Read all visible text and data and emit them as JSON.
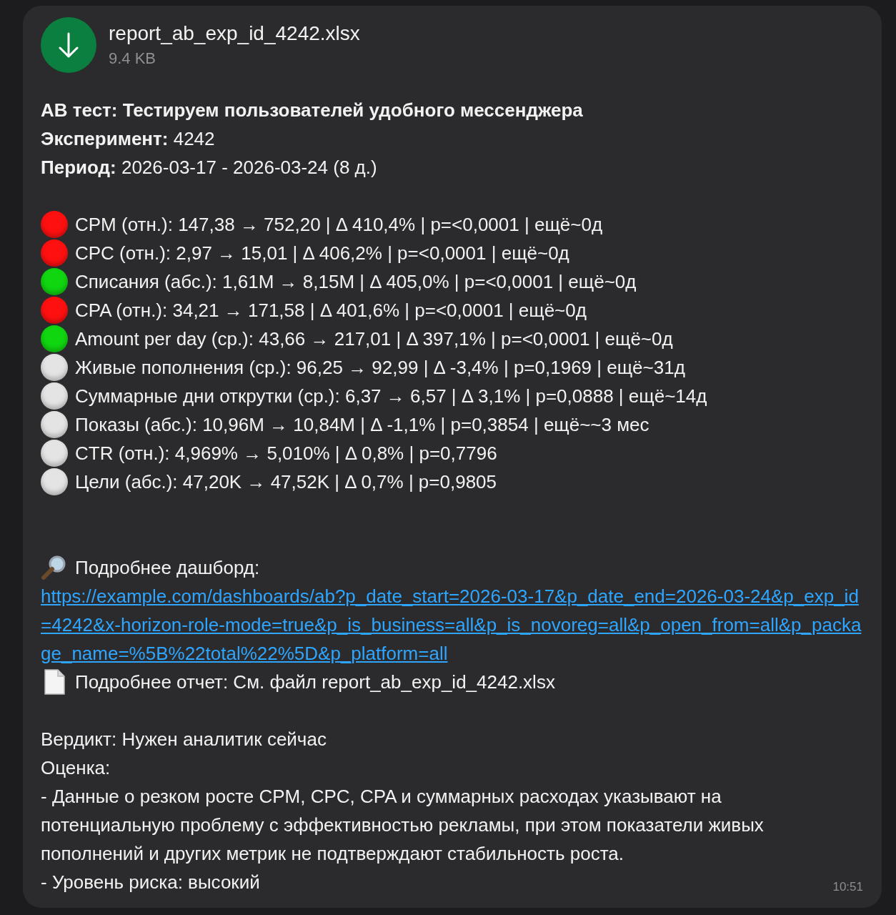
{
  "file": {
    "name": "report_ab_exp_id_4242.xlsx",
    "size": "9.4 KB"
  },
  "title": "АВ тест: Тестируем пользователей удобного мессенджера",
  "header_lines": [
    "**Эксперимент:** 4242",
    "**Период:** 2026-03-17 - 2026-03-24 (8 д.)"
  ],
  "metrics": [
    {
      "text": "CPM (отн.): 147,38 → 752,20 | Δ 410,4% | p=<0,0001 | ещё~0д",
      "color": "#ff1010"
    },
    {
      "text": "CPC (отн.): 2,97 → 15,01 | Δ 406,2% | p=<0,0001 | ещё~0д",
      "color": "#ff1010"
    },
    {
      "text": "Списания (абс.): 1,61M → 8,15M | Δ 405,0% | p=<0,0001 | ещё~0д",
      "color": "#10d610"
    },
    {
      "text": "CPA (отн.): 34,21 → 171,58 | Δ 401,6% | p=<0,0001 | ещё~0д",
      "color": "#ff1010"
    },
    {
      "text": "Amount per day (ср.): 43,66 → 217,01 | Δ 397,1% | p=<0,0001 | ещё~0д",
      "color": "#10d610"
    },
    {
      "text": "Живые пополнения (ср.): 96,25 → 92,99 | Δ -3,4% | p=0,1969 | ещё~31д",
      "color": "#e4e4e4"
    },
    {
      "text": "Суммарные дни открутки (ср.): 6,37 → 6,57 | Δ 3,1% | p=0,0888 | ещё~14д",
      "color": "#e4e4e4"
    },
    {
      "text": "Показы (абс.): 10,96M → 10,84M | Δ -1,1% | p=0,3854 | ещё~~3 мес",
      "color": "#e4e4e4"
    },
    {
      "text": "CTR (отн.): 4,969% → 5,010% | Δ 0,8% | p=0,7796",
      "color": "#e4e4e4"
    },
    {
      "text": "Цели (абс.): 47,20K → 47,52K | Δ 0,7% | p=0,9805",
      "color": "#e4e4e4"
    }
  ],
  "dashboard": {
    "label": "Подробнее дашборд:",
    "url": "https://example.com/dashboards/ab?p_date_start=2026-03-17&p_date_end=2026-03-24&p_exp_id=4242&x-horizon-role-mode=true&p_is_business=all&p_is_novoreg=all&p_open_from=all&p_package_name=%5B%22total%22%5D&p_platform=all"
  },
  "report_line": "Подробнее отчет: См. файл report_ab_exp_id_4242.xlsx",
  "verdict": "Вердикт: Нужен аналитик сейчас",
  "assessment_label": "Оценка:",
  "assessment": [
    "- Данные о резком росте CPM, CPC, CPA и суммарных расходах указывают на потенциальную проблему с эффективностью рекламы, при этом показатели живых пополнений и других метрик не подтверждают стабильность роста.",
    "- Уровень риска: высокий"
  ],
  "time": "10:51"
}
